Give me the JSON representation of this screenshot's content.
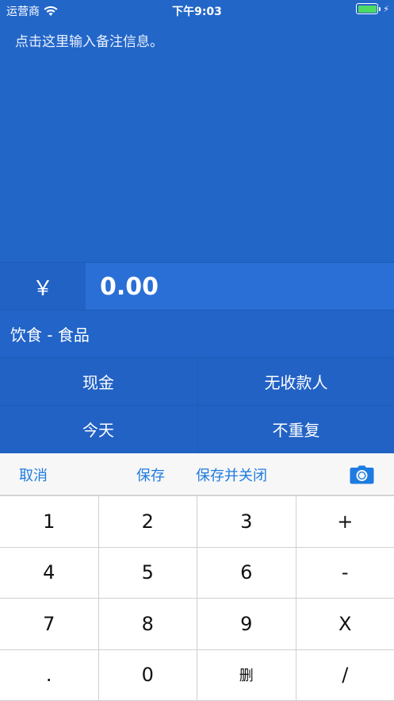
{
  "status_bar": {
    "carrier": "运营商",
    "time": "下午9:03",
    "wifi_icon": "wifi-icon",
    "battery_icon": "battery-icon",
    "charging_icon": "bolt-icon",
    "battery_color": "#4cd964"
  },
  "note": {
    "placeholder": "点击这里输入备注信息。"
  },
  "amount": {
    "currency": "￥",
    "value": "0.00"
  },
  "category": {
    "label": "饮食 - 食品"
  },
  "options": {
    "payment": "现金",
    "payee": "无收款人",
    "date": "今天",
    "repeat": "不重复"
  },
  "toolbar": {
    "cancel": "取消",
    "save": "保存",
    "save_close": "保存并关闭",
    "camera_icon": "camera-icon",
    "accent_color": "#1e7be0"
  },
  "keypad": {
    "keys": [
      "1",
      "2",
      "3",
      "+",
      "4",
      "5",
      "6",
      "-",
      "7",
      "8",
      "9",
      "X",
      ".",
      "0",
      "删",
      "/"
    ]
  },
  "colors": {
    "header_bg": "#2266c8",
    "amount_bg": "#2a6fd6"
  }
}
